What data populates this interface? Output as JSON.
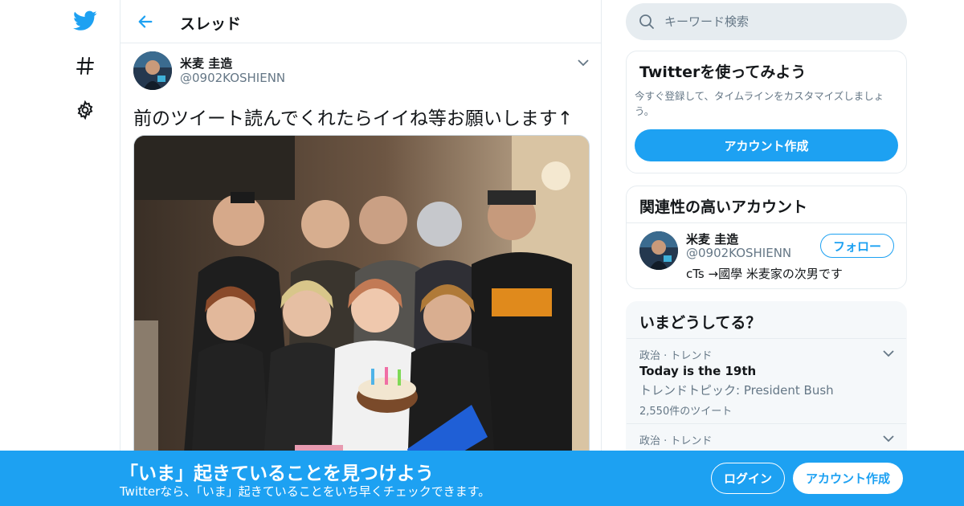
{
  "colors": {
    "accent": "#1da1f2",
    "text": "#14171a",
    "secondary": "#657786",
    "border": "#e6ecf0",
    "panel": "#f5f8fa"
  },
  "nav": {
    "icons": [
      "twitter-logo-icon",
      "hashtag-icon",
      "gear-icon"
    ]
  },
  "header": {
    "title": "スレッド"
  },
  "tweet": {
    "author_name": "米麦 圭造",
    "author_handle": "@0902KOSHIENN",
    "text": "前のツイート読んでくれたらイイね等お願いします↑"
  },
  "search": {
    "placeholder": "キーワード検索"
  },
  "signup_card": {
    "title": "Twitterを使ってみよう",
    "description": "今すぐ登録して、タイムラインをカスタマイズしましょう。",
    "button": "アカウント作成"
  },
  "related": {
    "title": "関連性の高いアカウント",
    "name": "米麦 圭造",
    "handle": "@0902KOSHIENN",
    "bio": "cTs →國學 米麦家の次男です",
    "follow_label": "フォロー"
  },
  "trends": {
    "title": "いまどうしてる？",
    "items": [
      {
        "meta": "政治 · トレンド",
        "name": "Today is the 19th",
        "topic": "トレンドトピック: President Bush",
        "count": "2,550件のツイート"
      },
      {
        "meta": "政治 · トレンド"
      }
    ]
  },
  "bottom_bar": {
    "title": "「いま」起きていることを見つけよう",
    "subtitle": "Twitterなら、「いま」起きていることをいち早くチェックできます。",
    "login": "ログイン",
    "signup": "アカウント作成"
  }
}
